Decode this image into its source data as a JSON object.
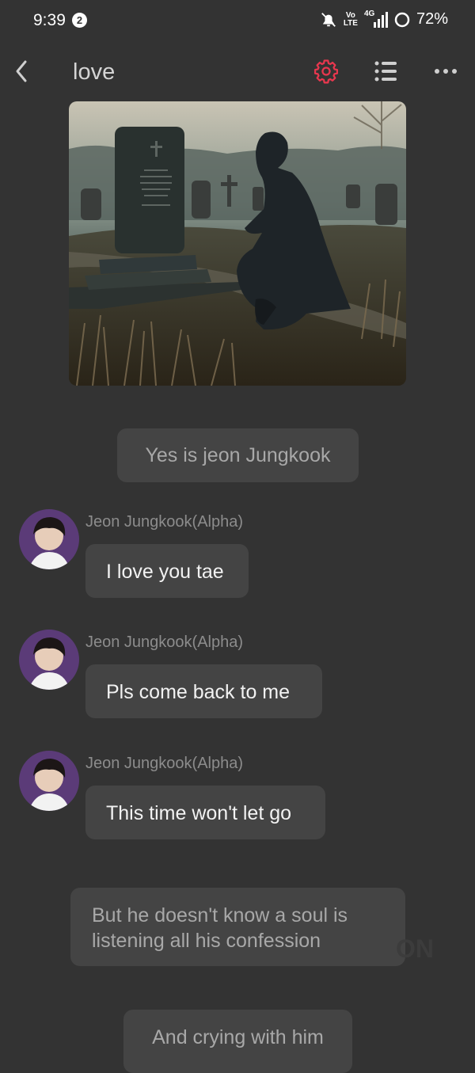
{
  "status_bar": {
    "time": "9:39",
    "notification_count": "2",
    "volte_top": "Vo",
    "volte_bottom": "LTE",
    "network": "4G",
    "battery": "72%"
  },
  "header": {
    "title": "love",
    "accent_color": "#e8374e"
  },
  "image": {
    "description_icon": "scene-image"
  },
  "messages": [
    {
      "type": "narration",
      "text": "Yes is jeon Jungkook"
    },
    {
      "type": "message",
      "sender": "Jeon Jungkook(Alpha)",
      "text": "I love you tae"
    },
    {
      "type": "message",
      "sender": "Jeon Jungkook(Alpha)",
      "text": "Pls come back to me"
    },
    {
      "type": "message",
      "sender": "Jeon Jungkook(Alpha)",
      "text": "This time won't let go"
    },
    {
      "type": "narration",
      "text": "But he doesn't know a soul is listening all his confession"
    },
    {
      "type": "narration",
      "text": "And crying with him"
    }
  ],
  "watermark": "ON"
}
